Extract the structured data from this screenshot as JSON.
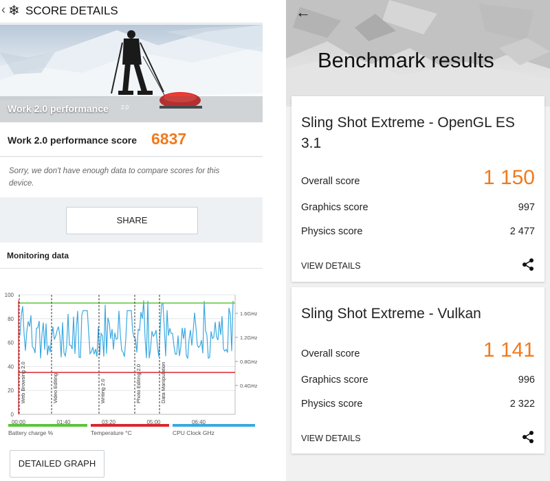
{
  "left": {
    "header": {
      "title": "SCORE DETAILS",
      "back_icon": "chevron-left-icon",
      "logo_icon": "snowflake-icon"
    },
    "hero": {
      "label": "Work 2.0 performance",
      "version": "2.0"
    },
    "score": {
      "label": "Work 2.0 performance score",
      "value": "6837"
    },
    "notice": "Sorry, we don't have enough data to compare scores for this device.",
    "share_label": "SHARE",
    "monitoring": {
      "title": "Monitoring data",
      "y_left_ticks": [
        "100",
        "80",
        "60",
        "40",
        "20",
        "0"
      ],
      "y_right_ticks": [
        "1.6GHz",
        "1.2GHz",
        "0.8GHz",
        "0.4GHz"
      ],
      "x_ticks": [
        "00:00",
        "01:40",
        "03:20",
        "05:00",
        "06:40"
      ],
      "sections": [
        "Web Browsing 2.0",
        "Video Editing",
        "Writing 2.0",
        "Photo Editing 2.0",
        "Data Manipulation"
      ],
      "legend": [
        {
          "label": "Battery charge %",
          "color": "#5cc43a"
        },
        {
          "label": "Temperature °C",
          "color": "#d9272e"
        },
        {
          "label": "CPU Clock GHz",
          "color": "#3aa8e0"
        }
      ]
    },
    "detailed_graph_label": "DETAILED GRAPH"
  },
  "right": {
    "back_icon": "arrow-left-icon",
    "title": "Benchmark results",
    "cards": [
      {
        "title": "Sling Shot Extreme - OpenGL ES 3.1",
        "overall_label": "Overall score",
        "overall_value": "1 150",
        "graphics_label": "Graphics score",
        "graphics_value": "997",
        "physics_label": "Physics score",
        "physics_value": "2 477",
        "view_details": "VIEW DETAILS"
      },
      {
        "title": "Sling Shot Extreme - Vulkan",
        "overall_label": "Overall score",
        "overall_value": "1 141",
        "graphics_label": "Graphics score",
        "graphics_value": "996",
        "physics_label": "Physics score",
        "physics_value": "2 322",
        "view_details": "VIEW DETAILS"
      }
    ]
  },
  "colors": {
    "accent": "#f07a1d",
    "battery": "#5cc43a",
    "temperature": "#d9272e",
    "cpu": "#3aa8e0"
  }
}
